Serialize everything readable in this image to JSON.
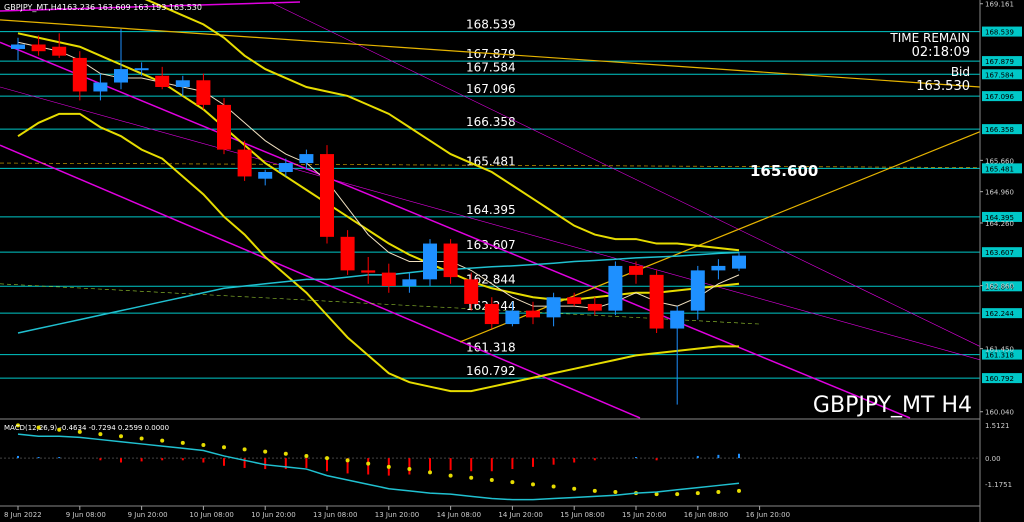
{
  "header": {
    "symbol": "GBPJPY_MT,H4",
    "ohlc": "163.236 163.609 163.193 163.530"
  },
  "info": {
    "time_remain_label": "TIME REMAIN",
    "time_remain": "02:18:09",
    "bid_label": "Bid",
    "bid": "163.530"
  },
  "watermark": "GBPJPY_MT H4",
  "target_label": "165.600",
  "colors": {
    "background": "#000000",
    "bull": "#1e90ff",
    "bear": "#ff0000",
    "level_line": "#00c8c8",
    "bollinger": "#e6dc00",
    "channel": "#e000e0",
    "trend": "#e6b400",
    "ma_fast": "#f0e0c0",
    "ma_slow": "#20c0d0",
    "macd_signal": "#e6dc00",
    "macd_line": "#20c0d0"
  },
  "chart_data": {
    "type": "candlestick",
    "price_axis": {
      "ylim": [
        159.9,
        169.2
      ],
      "ticks": [
        "169.161",
        "165.660",
        "164.960",
        "164.260",
        "162.860",
        "161.450",
        "160.040"
      ]
    },
    "time_axis": {
      "labels": [
        "8 Jun 2022",
        "9 Jun 08:00",
        "9 Jun 20:00",
        "10 Jun 08:00",
        "10 Jun 20:00",
        "13 Jun 08:00",
        "13 Jun 20:00",
        "14 Jun 08:00",
        "14 Jun 20:00",
        "15 Jun 08:00",
        "15 Jun 20:00",
        "16 Jun 08:00",
        "16 Jun 20:00"
      ],
      "label_candle_index": [
        0,
        3,
        6,
        9,
        12,
        15,
        18,
        21,
        24,
        27,
        30,
        33,
        36
      ]
    },
    "levels": [
      {
        "value": 168.539,
        "label": "168.539"
      },
      {
        "value": 167.879,
        "label": "167.879"
      },
      {
        "value": 167.584,
        "label": "167.584"
      },
      {
        "value": 167.096,
        "label": "167.096"
      },
      {
        "value": 166.358,
        "label": "166.358"
      },
      {
        "value": 165.481,
        "label": "165.481"
      },
      {
        "value": 164.395,
        "label": "164.395"
      },
      {
        "value": 163.607,
        "label": "163.607"
      },
      {
        "value": 162.844,
        "label": "162.844"
      },
      {
        "value": 162.244,
        "label": "162.244"
      },
      {
        "value": 161.318,
        "label": "161.318"
      },
      {
        "value": 160.792,
        "label": "160.792"
      }
    ],
    "candles": [
      {
        "o": 168.15,
        "h": 168.4,
        "l": 167.9,
        "c": 168.25
      },
      {
        "o": 168.25,
        "h": 168.45,
        "l": 168.0,
        "c": 168.1
      },
      {
        "o": 168.2,
        "h": 168.5,
        "l": 167.95,
        "c": 168.0
      },
      {
        "o": 167.95,
        "h": 168.1,
        "l": 167.0,
        "c": 167.2
      },
      {
        "o": 167.2,
        "h": 167.6,
        "l": 167.0,
        "c": 167.4
      },
      {
        "o": 167.4,
        "h": 168.6,
        "l": 167.25,
        "c": 167.7
      },
      {
        "o": 167.7,
        "h": 167.85,
        "l": 167.55,
        "c": 167.72
      },
      {
        "o": 167.55,
        "h": 167.75,
        "l": 167.25,
        "c": 167.3
      },
      {
        "o": 167.3,
        "h": 167.55,
        "l": 167.1,
        "c": 167.45
      },
      {
        "o": 167.45,
        "h": 167.6,
        "l": 166.8,
        "c": 166.9
      },
      {
        "o": 166.9,
        "h": 167.05,
        "l": 165.8,
        "c": 165.9
      },
      {
        "o": 165.9,
        "h": 166.1,
        "l": 165.2,
        "c": 165.3
      },
      {
        "o": 165.25,
        "h": 165.45,
        "l": 165.1,
        "c": 165.4
      },
      {
        "o": 165.4,
        "h": 165.7,
        "l": 165.3,
        "c": 165.6
      },
      {
        "o": 165.6,
        "h": 165.9,
        "l": 165.45,
        "c": 165.8
      },
      {
        "o": 165.8,
        "h": 166.0,
        "l": 163.8,
        "c": 163.95
      },
      {
        "o": 163.95,
        "h": 164.1,
        "l": 163.1,
        "c": 163.2
      },
      {
        "o": 163.2,
        "h": 163.5,
        "l": 162.9,
        "c": 163.15
      },
      {
        "o": 163.15,
        "h": 163.35,
        "l": 162.7,
        "c": 162.85
      },
      {
        "o": 162.85,
        "h": 163.15,
        "l": 162.7,
        "c": 163.0
      },
      {
        "o": 163.0,
        "h": 163.9,
        "l": 162.85,
        "c": 163.8
      },
      {
        "o": 163.8,
        "h": 163.9,
        "l": 162.9,
        "c": 163.05
      },
      {
        "o": 163.0,
        "h": 163.15,
        "l": 162.3,
        "c": 162.45
      },
      {
        "o": 162.45,
        "h": 162.6,
        "l": 161.9,
        "c": 162.0
      },
      {
        "o": 162.0,
        "h": 162.5,
        "l": 161.95,
        "c": 162.3
      },
      {
        "o": 162.3,
        "h": 162.5,
        "l": 162.0,
        "c": 162.15
      },
      {
        "o": 162.15,
        "h": 162.7,
        "l": 161.95,
        "c": 162.6
      },
      {
        "o": 162.6,
        "h": 162.7,
        "l": 162.4,
        "c": 162.45
      },
      {
        "o": 162.45,
        "h": 162.6,
        "l": 162.2,
        "c": 162.3
      },
      {
        "o": 162.3,
        "h": 163.4,
        "l": 162.2,
        "c": 163.3
      },
      {
        "o": 163.3,
        "h": 163.4,
        "l": 162.9,
        "c": 163.1
      },
      {
        "o": 163.1,
        "h": 163.2,
        "l": 161.8,
        "c": 161.9
      },
      {
        "o": 161.9,
        "h": 162.4,
        "l": 160.2,
        "c": 162.3
      },
      {
        "o": 162.3,
        "h": 163.3,
        "l": 162.1,
        "c": 163.2
      },
      {
        "o": 163.2,
        "h": 163.45,
        "l": 163.0,
        "c": 163.3
      },
      {
        "o": 163.24,
        "h": 163.61,
        "l": 163.19,
        "c": 163.53
      }
    ],
    "bollinger": {
      "upper": [
        170.8,
        170.3,
        169.9,
        169.7,
        169.6,
        169.4,
        169.3,
        169.1,
        168.9,
        168.7,
        168.4,
        168.0,
        167.7,
        167.5,
        167.3,
        167.2,
        167.1,
        166.9,
        166.7,
        166.4,
        166.1,
        165.8,
        165.6,
        165.4,
        165.1,
        164.8,
        164.5,
        164.2,
        164.0,
        163.9,
        163.9,
        163.8,
        163.8,
        163.75,
        163.7,
        163.65
      ],
      "middle": [
        168.5,
        168.4,
        168.3,
        168.2,
        168.0,
        167.8,
        167.6,
        167.4,
        167.1,
        166.8,
        166.4,
        166.0,
        165.6,
        165.3,
        165.0,
        164.7,
        164.4,
        164.1,
        163.8,
        163.55,
        163.35,
        163.15,
        162.95,
        162.8,
        162.7,
        162.6,
        162.55,
        162.55,
        162.6,
        162.65,
        162.7,
        162.7,
        162.75,
        162.8,
        162.85,
        162.9
      ],
      "lower": [
        166.2,
        166.5,
        166.7,
        166.7,
        166.4,
        166.2,
        165.9,
        165.7,
        165.3,
        164.9,
        164.4,
        164.0,
        163.5,
        163.1,
        162.7,
        162.2,
        161.7,
        161.3,
        160.9,
        160.7,
        160.6,
        160.5,
        160.5,
        160.6,
        160.7,
        160.8,
        160.9,
        161.0,
        161.1,
        161.2,
        161.3,
        161.35,
        161.4,
        161.45,
        161.5,
        161.5
      ]
    },
    "ma_fast": [
      168.3,
      168.2,
      168.1,
      167.9,
      167.6,
      167.5,
      167.5,
      167.4,
      167.3,
      167.2,
      166.9,
      166.5,
      166.1,
      165.8,
      165.6,
      165.2,
      164.6,
      164.0,
      163.6,
      163.4,
      163.4,
      163.4,
      163.2,
      162.9,
      162.6,
      162.4,
      162.4,
      162.4,
      162.35,
      162.5,
      162.7,
      162.5,
      162.4,
      162.6,
      162.9,
      163.1
    ],
    "ma_slow": [
      161.8,
      161.9,
      162.0,
      162.1,
      162.2,
      162.3,
      162.4,
      162.5,
      162.6,
      162.7,
      162.8,
      162.85,
      162.9,
      162.95,
      163.0,
      163.0,
      163.05,
      163.1,
      163.1,
      163.15,
      163.2,
      163.22,
      163.25,
      163.28,
      163.3,
      163.33,
      163.36,
      163.4,
      163.42,
      163.45,
      163.48,
      163.5,
      163.52,
      163.55,
      163.58,
      163.6
    ],
    "macd": {
      "label": "MACD(12,26,9) -0.4634 -0.7294 0.2599 0.0000",
      "ylim": [
        -2.1,
        1.7
      ],
      "ticks": [
        "1.5121",
        "0.00",
        "-1.1751"
      ],
      "histogram": [
        0.1,
        0.05,
        0.05,
        0.0,
        -0.1,
        -0.2,
        -0.15,
        -0.1,
        -0.1,
        -0.2,
        -0.35,
        -0.45,
        -0.5,
        -0.5,
        -0.45,
        -0.6,
        -0.7,
        -0.75,
        -0.8,
        -0.75,
        -0.6,
        -0.55,
        -0.6,
        -0.6,
        -0.5,
        -0.4,
        -0.3,
        -0.2,
        -0.1,
        0.0,
        0.05,
        -0.1,
        0.0,
        0.1,
        0.15,
        0.2
      ],
      "signal": [
        1.5,
        1.4,
        1.3,
        1.2,
        1.1,
        1.0,
        0.9,
        0.8,
        0.7,
        0.6,
        0.5,
        0.4,
        0.3,
        0.2,
        0.1,
        0.0,
        -0.1,
        -0.25,
        -0.4,
        -0.5,
        -0.65,
        -0.8,
        -0.9,
        -1.0,
        -1.1,
        -1.2,
        -1.3,
        -1.4,
        -1.5,
        -1.55,
        -1.6,
        -1.65,
        -1.65,
        -1.6,
        -1.55,
        -1.5
      ],
      "line": [
        1.1,
        1.0,
        1.0,
        0.95,
        0.85,
        0.75,
        0.65,
        0.55,
        0.45,
        0.35,
        0.1,
        -0.1,
        -0.3,
        -0.4,
        -0.5,
        -0.8,
        -1.0,
        -1.2,
        -1.4,
        -1.5,
        -1.6,
        -1.65,
        -1.75,
        -1.85,
        -1.9,
        -1.9,
        -1.85,
        -1.8,
        -1.75,
        -1.7,
        -1.6,
        -1.55,
        -1.45,
        -1.35,
        -1.25,
        -1.15
      ]
    }
  }
}
